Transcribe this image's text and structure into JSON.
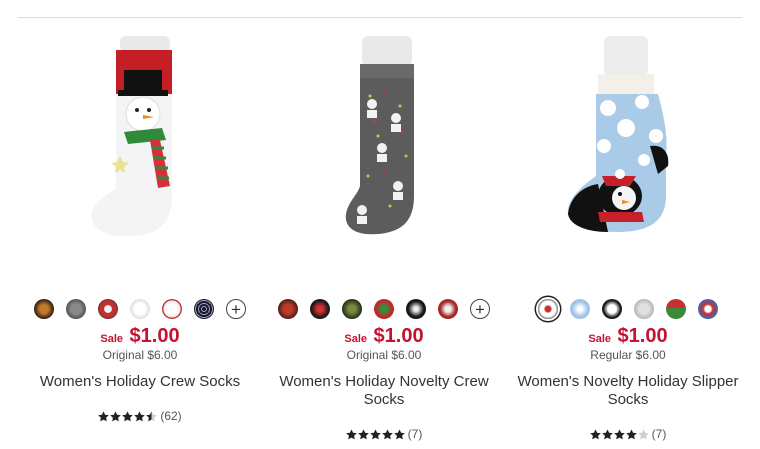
{
  "products": [
    {
      "sale_label": "Sale",
      "sale_price": "$1.00",
      "original_price": "Original $6.00",
      "title": "Women's Holiday Crew Socks",
      "rating_count": "(62)",
      "rating_value": 4.5,
      "swatch_colors": [
        "#5a2b1a",
        "#6a6a6a",
        "#c83a3a",
        "#e8e8ee",
        "#f2f2f2",
        "#2a2a3a"
      ],
      "has_more_swatches": true,
      "more_swatches_label": "+"
    },
    {
      "sale_label": "Sale",
      "sale_price": "$1.00",
      "original_price": "Original $6.00",
      "title": "Women's Holiday Novelty Crew Socks",
      "rating_count": "(7)",
      "rating_value": 5,
      "swatch_colors": [
        "#7a2a1a",
        "#2a2a2a",
        "#3a4a2a",
        "#b8302a",
        "#1a1a1a",
        "#a82828"
      ],
      "has_more_swatches": true,
      "more_swatches_label": "+"
    },
    {
      "sale_label": "Sale",
      "sale_price": "$1.00",
      "original_price": "Regular $6.00",
      "title": "Women's Novelty Holiday Slipper Socks",
      "rating_count": "(7)",
      "rating_value": 4,
      "swatch_colors": [
        "#d9e6f2",
        "#9ec3e6",
        "#1a1a1a",
        "#c8c8c8",
        "#c83030",
        "#3a6ab8"
      ],
      "has_more_swatches": false,
      "more_swatches_label": ""
    }
  ],
  "colors": {
    "sale": "#c41230",
    "text": "#333333"
  }
}
